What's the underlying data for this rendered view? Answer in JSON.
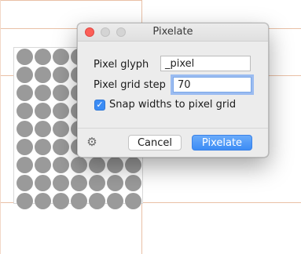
{
  "dialog": {
    "title": "Pixelate",
    "pixel_glyph_label": "Pixel glyph",
    "pixel_glyph_value": "_pixel",
    "grid_step_label": "Pixel grid step",
    "grid_step_value": "70",
    "snap_label": "Snap widths to pixel grid",
    "snap_checked": true,
    "cancel_label": "Cancel",
    "confirm_label": "Pixelate",
    "settings_icon": "gear-icon",
    "accent_color": "#3b8cf5"
  },
  "canvas": {
    "dot_color": "#9a9a9a",
    "guide_color": "#e9c0a6"
  }
}
